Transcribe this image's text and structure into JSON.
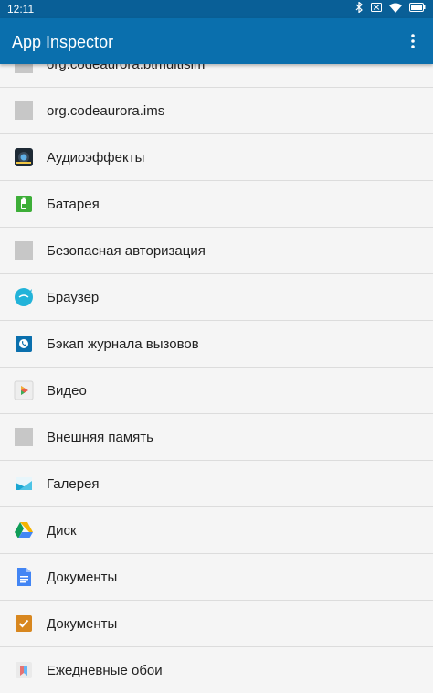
{
  "status_bar": {
    "time": "12:11"
  },
  "app_bar": {
    "title": "App Inspector"
  },
  "apps": [
    {
      "label": "org.codeaurora.btmultisim",
      "icon": "generic-app-icon"
    },
    {
      "label": "org.codeaurora.ims",
      "icon": "generic-app-icon"
    },
    {
      "label": "Аудиоэффекты",
      "icon": "audio-effects-icon"
    },
    {
      "label": "Батарея",
      "icon": "battery-icon"
    },
    {
      "label": "Безопасная авторизация",
      "icon": "generic-app-icon"
    },
    {
      "label": "Браузер",
      "icon": "browser-icon"
    },
    {
      "label": "Бэкап журнала вызовов",
      "icon": "call-log-backup-icon"
    },
    {
      "label": "Видео",
      "icon": "video-icon"
    },
    {
      "label": "Внешняя память",
      "icon": "generic-app-icon"
    },
    {
      "label": "Галерея",
      "icon": "gallery-icon"
    },
    {
      "label": "Диск",
      "icon": "drive-icon"
    },
    {
      "label": "Документы",
      "icon": "docs-icon"
    },
    {
      "label": "Документы",
      "icon": "documents-icon"
    },
    {
      "label": "Ежедневные обои",
      "icon": "daily-wallpaper-icon"
    }
  ]
}
